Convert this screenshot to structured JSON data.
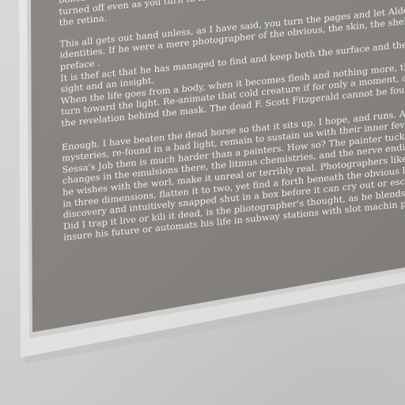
{
  "text_lines": [
    "bones and marrow in the bones to the mysterious source that illumines it all. Da Vinci pai",
    "turned off even as you turn to leave the gallery, but walk away with the implied source ben",
    "the retina.",
    "",
    "This all gets out hand unless, as I have said, you turn the pages and let Aldo Sessa's seances",
    "identities. If he were a mere photographer of the obvious, the skin, the shell, the outer sub",
    "preface .",
    "It is thef act that he has managed to find and keep both the surface and the spirit beneath t",
    "sight and an insight.",
    "When the life goes from a body, when it becomes flesh and nothing more, the more we lo",
    "turn toward the light. Re-animate that cold creature if for only a moment, and we turn ba",
    "the revelation behind the mask. The dead F. Scott Fitzgerald cannot be found at his grave.",
    "",
    "Enough. I have beaten the dead horse so that it sits up, I hope, and runs. All the things in t",
    "mysteries, re-found in a bad light, remain to sustain us with their inner fevers.",
    "Sessa's Job then is much harder than a painters. How so? The painter tucks the real world b",
    "changes in the emulsions there, the litmus chemistries, and the nerve endings that lead to",
    "he wishes with the worl, make it unreal or terribly real. Photographers like  Sessa lack that",
    "in three dimensions, flatten it to two, yet find a forth beneath the obvious look . It must be",
    "discovery and intuitively snapped shut in a box before it can cry out or escape. The darkro",
    "Did I trap it live or kili it dead, is the pliotographer's thought, as he blends his chemistries,",
    "insure his future or automats his life in subway stations with slot machin pix, six poses for"
  ]
}
